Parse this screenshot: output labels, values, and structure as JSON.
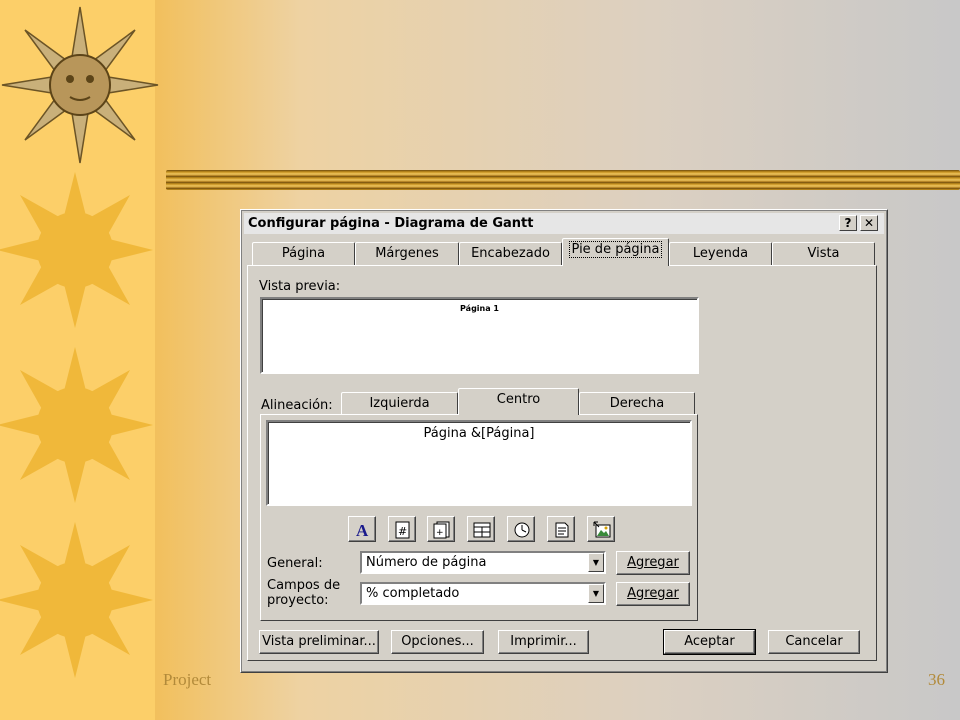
{
  "slide": {
    "footer_left": "Project",
    "page_number": "36"
  },
  "dialog": {
    "title": "Configurar página - Diagrama de Gantt",
    "help_label": "?",
    "close_label": "✕",
    "tabs": [
      {
        "label": "Página"
      },
      {
        "label": "Márgenes"
      },
      {
        "label": "Encabezado"
      },
      {
        "label": "Pie de página",
        "active": true
      },
      {
        "label": "Leyenda"
      },
      {
        "label": "Vista"
      }
    ],
    "preview_label": "Vista previa:",
    "preview_text": "Página 1",
    "alignment_label": "Alineación:",
    "align_tabs": [
      {
        "label": "Izquierda"
      },
      {
        "label": "Centro",
        "active": true
      },
      {
        "label": "Derecha"
      }
    ],
    "footer_text": "Página &[Página]",
    "toolbar_icons": [
      "format-text-icon",
      "page-number-icon",
      "total-pages-icon",
      "current-date-icon",
      "current-time-icon",
      "file-name-icon",
      "insert-picture-icon"
    ],
    "general_label": "General:",
    "general_value": "Número de página",
    "fields_label_line1": "Campos de",
    "fields_label_line2": "proyecto:",
    "fields_value": "% completado",
    "add_label": "Agregar",
    "buttons": {
      "preview": "Vista preliminar...",
      "options": "Opciones...",
      "print": "Imprimir...",
      "accept": "Aceptar",
      "cancel": "Cancelar"
    }
  }
}
